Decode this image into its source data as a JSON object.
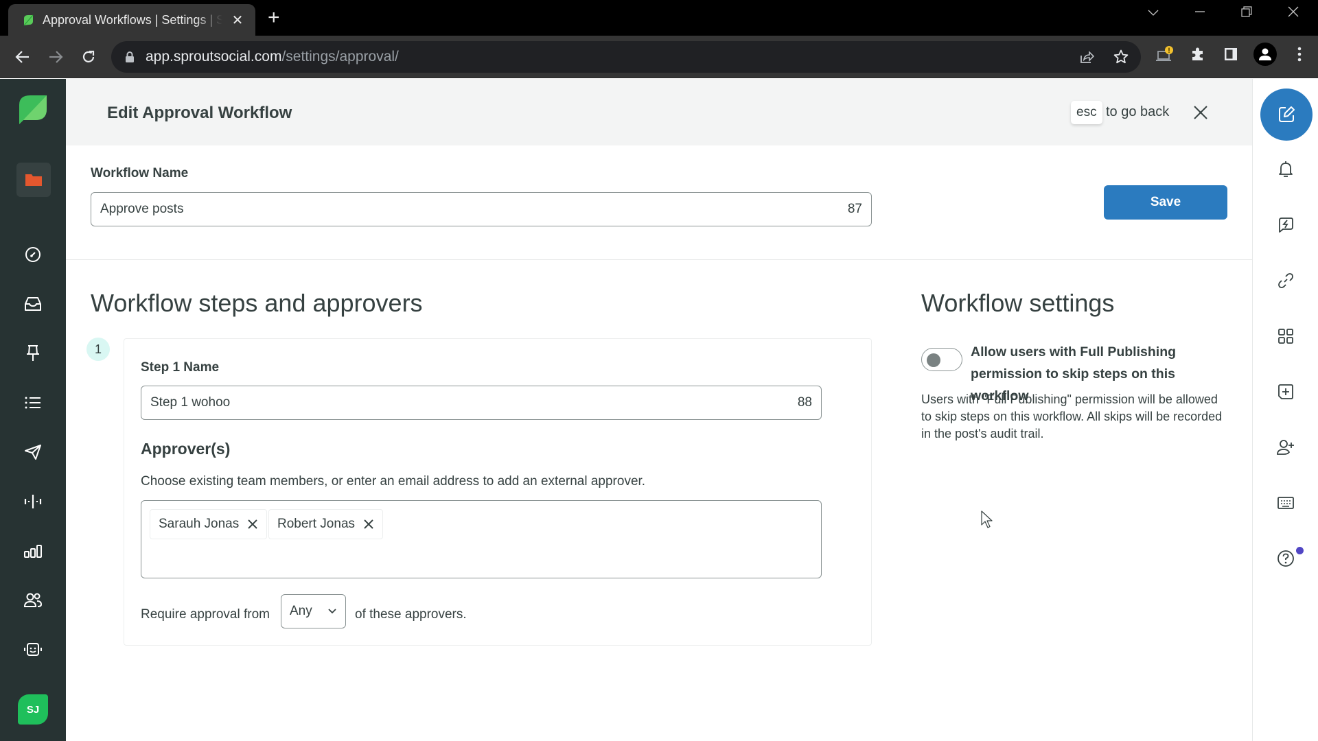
{
  "browser": {
    "tab_title": "Approval Workflows | Settings | Sprout Social",
    "new_tab_label": "+",
    "url_host": "app.sproutsocial.com",
    "url_path": "/settings/approval/",
    "window_controls": [
      "chevron-down",
      "minimize",
      "restore",
      "close"
    ]
  },
  "left_rail": {
    "items": [
      {
        "icon": "folder-icon",
        "active": true
      },
      {
        "icon": "dashboard-icon"
      },
      {
        "icon": "inbox-icon"
      },
      {
        "icon": "pin-icon"
      },
      {
        "icon": "list-icon"
      },
      {
        "icon": "send-icon"
      },
      {
        "icon": "listening-icon"
      },
      {
        "icon": "reports-icon"
      },
      {
        "icon": "people-icon"
      },
      {
        "icon": "bot-icon"
      }
    ],
    "avatar_initials": "SJ",
    "brand_color": "#1fbf5b"
  },
  "right_rail": {
    "items": [
      "compose-icon",
      "bell-icon",
      "quick-reply-icon",
      "link-icon",
      "apps-grid-icon",
      "add-icon",
      "add-user-icon",
      "keyboard-icon",
      "help-icon"
    ],
    "help_has_notification": true,
    "accent_color": "#2b7bbf"
  },
  "header": {
    "title": "Edit Approval Workflow",
    "esc_key": "esc",
    "esc_text": "to go back"
  },
  "workflow_name": {
    "label": "Workflow Name",
    "value": "Approve posts",
    "remaining_chars": "87"
  },
  "save_label": "Save",
  "steps_section": {
    "title": "Workflow steps and approvers",
    "steps": [
      {
        "number": "1",
        "name_label": "Step 1 Name",
        "name_value": "Step 1 wohoo",
        "remaining_chars": "88",
        "approvers_title": "Approver(s)",
        "approvers_help": "Choose existing team members, or enter an email address to add an external approver.",
        "approvers": [
          "Sarauh Jonas",
          "Robert Jonas"
        ],
        "require_prefix": "Require approval from",
        "require_value": "Any",
        "require_suffix": "of these approvers."
      }
    ]
  },
  "settings_section": {
    "title": "Workflow settings",
    "toggle_label": "Allow users with Full Publishing permission to skip steps on this workflow",
    "toggle_on": false,
    "description": "Users with \"Full Publishing\" permission will be allowed to skip steps on this workflow. All skips will be recorded in the post's audit trail."
  }
}
